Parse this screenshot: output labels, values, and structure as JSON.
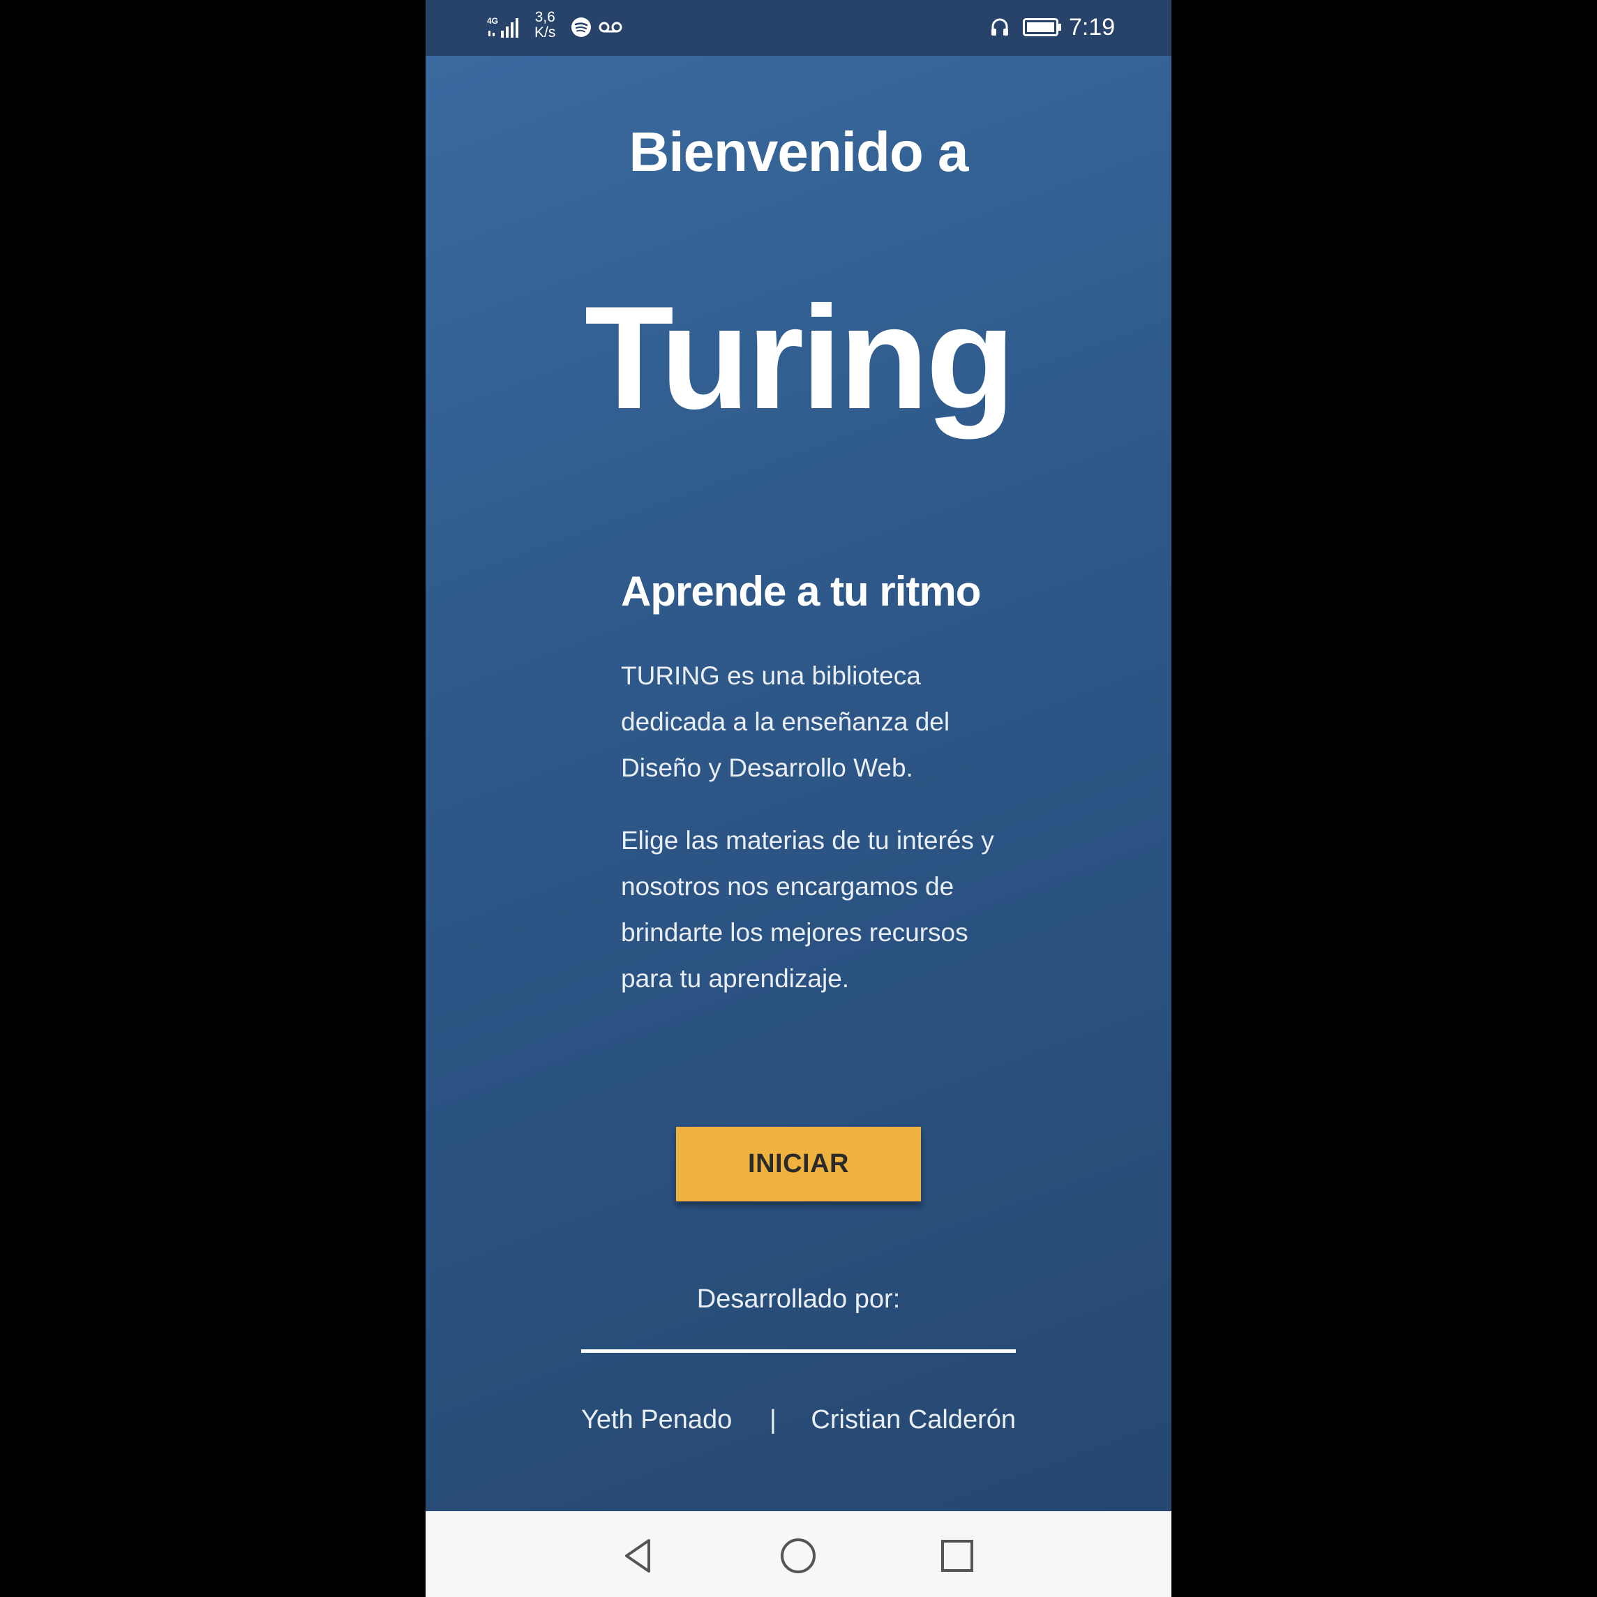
{
  "status_bar": {
    "network_type": "4G",
    "speed_value": "3,6",
    "speed_unit": "K/s",
    "icons": [
      "signal-icon",
      "spotify-icon",
      "voicemail-icon",
      "headset-icon",
      "battery-icon"
    ],
    "time": "7:19"
  },
  "welcome": {
    "heading": "Bienvenido a",
    "brand": "Turing"
  },
  "intro": {
    "tagline": "Aprende a tu ritmo",
    "paragraph_1": "TURING es una biblioteca dedicada a la enseñanza del Diseño y Desarrollo Web.",
    "paragraph_2": "Elige las materias de tu interés y nosotros nos encargamos de brindarte los mejores recursos para tu aprendizaje."
  },
  "actions": {
    "start_label": "INICIAR"
  },
  "credits": {
    "label": "Desarrollado por:",
    "author_1": "Yeth Penado",
    "separator": "|",
    "author_2": "Cristian Calderón"
  },
  "navigation": {
    "buttons": [
      "back-icon",
      "home-icon",
      "recents-icon"
    ]
  },
  "colors": {
    "background_top": "#3a6a9f",
    "background_bottom": "#264870",
    "status_bar": "#27436a",
    "button": "#efb23e",
    "nav_bar": "#f7f7f7"
  }
}
